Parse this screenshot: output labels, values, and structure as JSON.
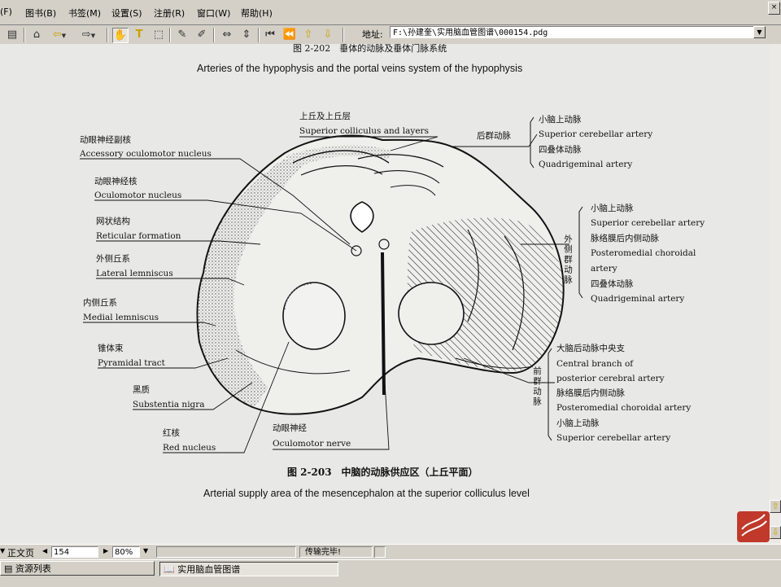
{
  "menu": {
    "items": [
      "(F)",
      "图书(B)",
      "书签(M)",
      "设置(S)",
      "注册(R)",
      "窗口(W)",
      "帮助(H)"
    ]
  },
  "toolbar": {
    "address_label": "地址:",
    "address_value": "F:\\孙建奎\\实用脑血管图谱\\000154.pdg"
  },
  "figure": {
    "top_caption_cn": "图 2-202　垂体的动脉及垂体门脉系统",
    "top_caption_en": "Arteries of the hypophysis and the portal veins system of the hypophysis",
    "bottom_caption_cn": "图 2-203　中脑的动脉供应区（上丘平面）",
    "bottom_caption_en": "Arterial supply area of the mesencephalon at the superior colliculus level",
    "left_labels": [
      {
        "cn": "动眼神经副核",
        "en": "Accessory oculomotor nucleus"
      },
      {
        "cn": "动眼神经核",
        "en": "Oculomotor nucleus"
      },
      {
        "cn": "网状结构",
        "en": "Reticular formation"
      },
      {
        "cn": "外侧丘系",
        "en": "Lateral lemniscus"
      },
      {
        "cn": "内侧丘系",
        "en": "Medial lemniscus"
      },
      {
        "cn": "锥体束",
        "en": "Pyramidal tract"
      },
      {
        "cn": "黑质",
        "en": "Substentia nigra"
      },
      {
        "cn": "红核",
        "en": "Red nucleus"
      }
    ],
    "bottom_label": {
      "cn": "动眼神经",
      "en": "Oculomotor nerve"
    },
    "top_label": {
      "cn": "上丘及上丘层",
      "en": "Superior colliculus and layers"
    },
    "posterior_group": "后群动脉",
    "right_top": [
      "小脑上动脉",
      "Superior cerebellar artery",
      "四叠体动脉",
      "Quadrigeminal artery"
    ],
    "lateral_group": "外侧群动脉",
    "right_mid": [
      "小脑上动脉",
      "Superior cerebellar artery",
      "脉络膜后内侧动脉",
      "Posteromedial choroidal",
      "artery",
      "四叠体动脉",
      "Quadrigeminal artery"
    ],
    "anterior_group": "前群动脉",
    "right_bottom": [
      "大脑后动脉中央支",
      "Central branch of",
      "posterior cerebral artery",
      "脉络膜后内侧动脉",
      "Posteromedial choroidal artery",
      "小脑上动脉",
      "Superior cerebellar artery"
    ]
  },
  "status": {
    "mode": "正文页",
    "page": "154",
    "zoom": "80%",
    "message": "传输完毕!"
  },
  "taskbar": {
    "left_item": "资源列表",
    "active_item": "实用脑血管图谱"
  }
}
